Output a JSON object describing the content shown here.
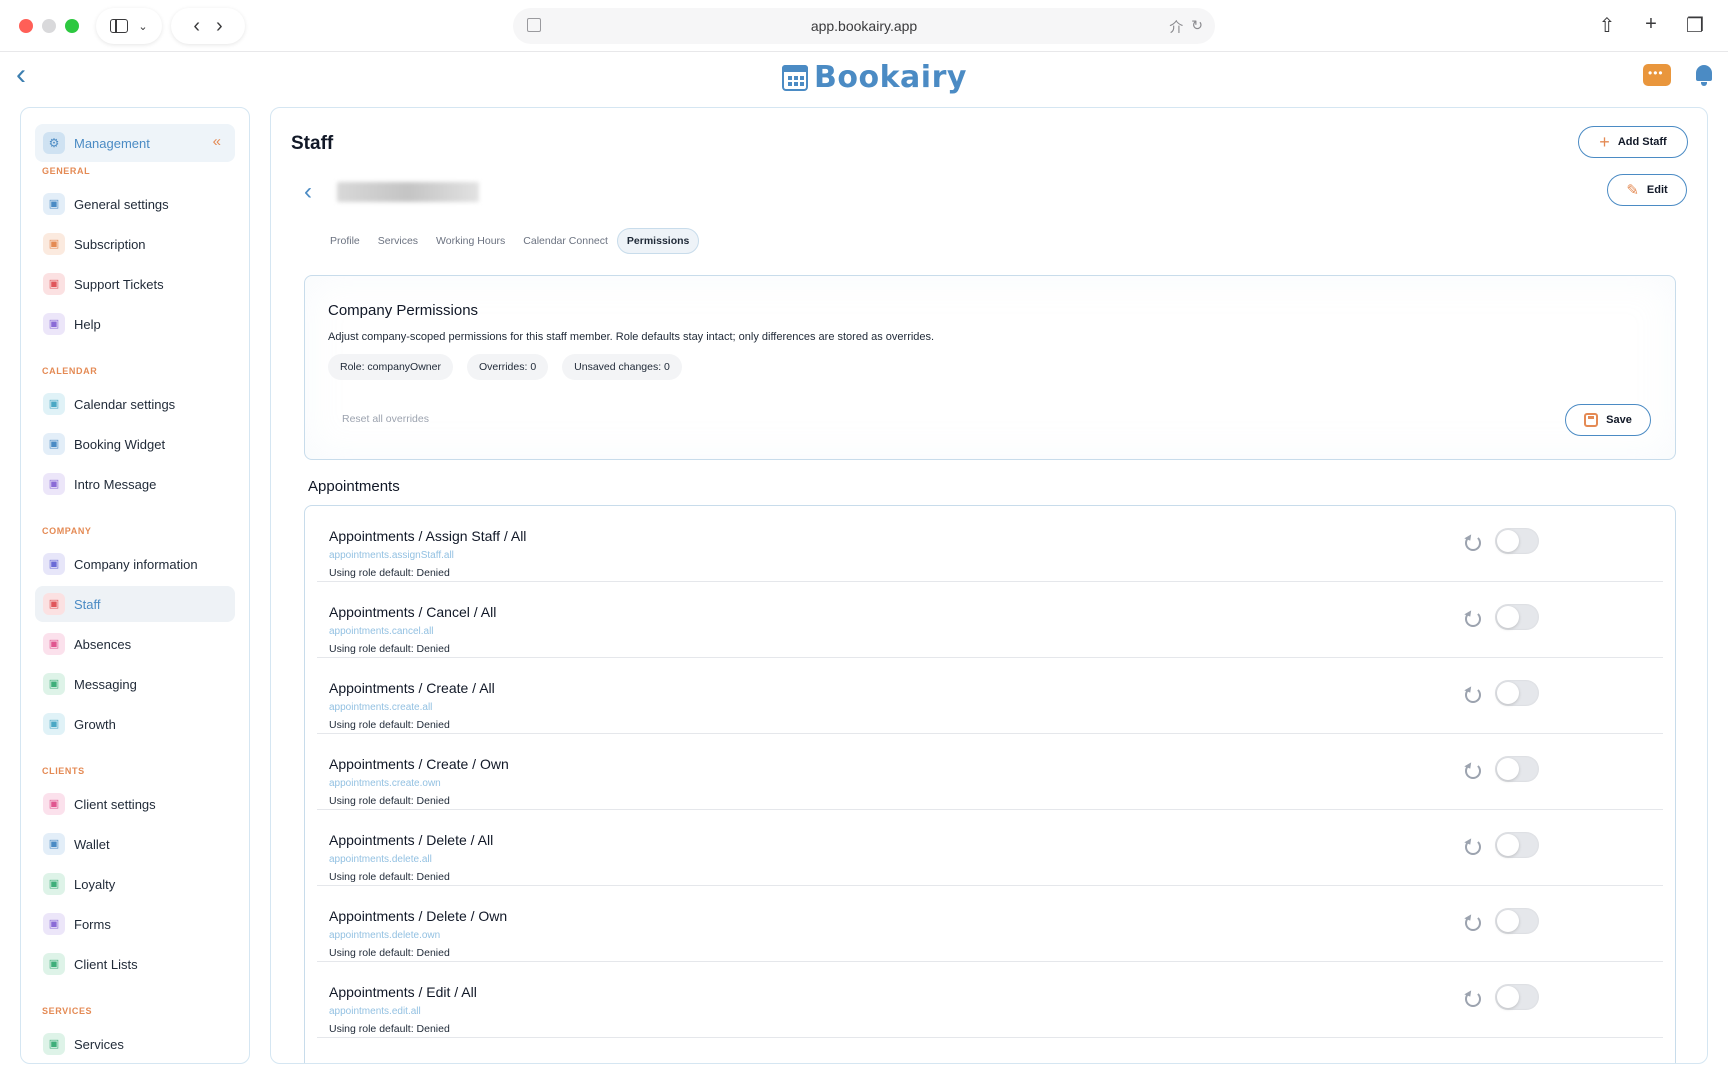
{
  "browser": {
    "url": "app.bookairy.app"
  },
  "app": {
    "logo_text": "Bookairy"
  },
  "sidebar": {
    "header_label": "Management",
    "sections": [
      {
        "title": "GENERAL",
        "items": [
          {
            "label": "General settings",
            "icon": "sliders-icon",
            "color": "#4b8bc4",
            "bg": "#e3eef8"
          },
          {
            "label": "Subscription",
            "icon": "badge-icon",
            "color": "#e48a54",
            "bg": "#fbeadf"
          },
          {
            "label": "Support Tickets",
            "icon": "headset-icon",
            "color": "#e0565b",
            "bg": "#fbe1e2"
          },
          {
            "label": "Help",
            "icon": "help-icon",
            "color": "#8a6bd6",
            "bg": "#ece6f9"
          }
        ]
      },
      {
        "title": "CALENDAR",
        "items": [
          {
            "label": "Calendar settings",
            "icon": "calendar-icon",
            "color": "#4ba8c4",
            "bg": "#e0f2f7"
          },
          {
            "label": "Booking Widget",
            "icon": "widget-icon",
            "color": "#4b8bc4",
            "bg": "#e3eef8"
          },
          {
            "label": "Intro Message",
            "icon": "message-icon",
            "color": "#8a6bd6",
            "bg": "#ece6f9"
          }
        ]
      },
      {
        "title": "COMPANY",
        "items": [
          {
            "label": "Company information",
            "icon": "building-icon",
            "color": "#6b6bd6",
            "bg": "#e7e6f9"
          },
          {
            "label": "Staff",
            "icon": "users-icon",
            "color": "#e0565b",
            "bg": "#fbe1e2",
            "active": true
          },
          {
            "label": "Absences",
            "icon": "calendar-x-icon",
            "color": "#e0568f",
            "bg": "#fbe1ec"
          },
          {
            "label": "Messaging",
            "icon": "chat-icon",
            "color": "#3fae7a",
            "bg": "#def3e8"
          },
          {
            "label": "Growth",
            "icon": "trend-icon",
            "color": "#4ba8c4",
            "bg": "#e0f2f7"
          }
        ]
      },
      {
        "title": "CLIENTS",
        "items": [
          {
            "label": "Client settings",
            "icon": "user-icon",
            "color": "#e0568f",
            "bg": "#fbe1ec"
          },
          {
            "label": "Wallet",
            "icon": "wallet-icon",
            "color": "#4b8bc4",
            "bg": "#e3eef8"
          },
          {
            "label": "Loyalty",
            "icon": "tag-icon",
            "color": "#3fae7a",
            "bg": "#def3e8"
          },
          {
            "label": "Forms",
            "icon": "form-icon",
            "color": "#8a6bd6",
            "bg": "#ece6f9"
          },
          {
            "label": "Client Lists",
            "icon": "list-icon",
            "color": "#3fae7a",
            "bg": "#def3e8"
          }
        ]
      },
      {
        "title": "SERVICES",
        "items": [
          {
            "label": "Services",
            "icon": "gem-icon",
            "color": "#3fae7a",
            "bg": "#def3e8"
          }
        ]
      }
    ]
  },
  "main": {
    "title": "Staff",
    "add_staff_label": "Add Staff",
    "edit_label": "Edit",
    "tabs": [
      "Profile",
      "Services",
      "Working Hours",
      "Calendar Connect",
      "Permissions"
    ],
    "active_tab": "Permissions",
    "company_permissions": {
      "title": "Company Permissions",
      "description": "Adjust company-scoped permissions for this staff member. Role defaults stay intact; only differences are stored as overrides.",
      "role_chip": "Role: companyOwner",
      "overrides_chip": "Overrides: 0",
      "unsaved_chip": "Unsaved changes: 0",
      "reset_all_label": "Reset all overrides",
      "save_label": "Save"
    },
    "appointments_heading": "Appointments",
    "permissions": [
      {
        "title": "Appointments / Assign Staff / All",
        "key": "appointments.assignStaff.all",
        "status": "Using role default: Denied",
        "enabled": false
      },
      {
        "title": "Appointments / Cancel / All",
        "key": "appointments.cancel.all",
        "status": "Using role default: Denied",
        "enabled": false
      },
      {
        "title": "Appointments / Create / All",
        "key": "appointments.create.all",
        "status": "Using role default: Denied",
        "enabled": false
      },
      {
        "title": "Appointments / Create / Own",
        "key": "appointments.create.own",
        "status": "Using role default: Denied",
        "enabled": false
      },
      {
        "title": "Appointments / Delete / All",
        "key": "appointments.delete.all",
        "status": "Using role default: Denied",
        "enabled": false
      },
      {
        "title": "Appointments / Delete / Own",
        "key": "appointments.delete.own",
        "status": "Using role default: Denied",
        "enabled": false
      },
      {
        "title": "Appointments / Edit / All",
        "key": "appointments.edit.all",
        "status": "Using role default: Denied",
        "enabled": false
      }
    ]
  }
}
